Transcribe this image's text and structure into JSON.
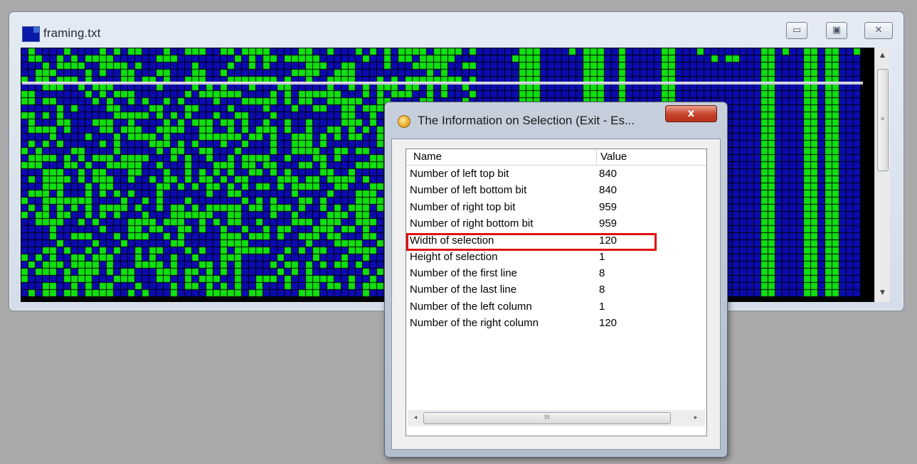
{
  "main_window": {
    "title": "framing.txt",
    "buttons": {
      "minimize": "▭",
      "maximize": "▣",
      "close": "✕"
    },
    "colors": {
      "bit_zero": "#0b0bb0",
      "bit_one": "#10e010",
      "background": "#000000",
      "selection_line": "#c7c7d8"
    }
  },
  "scrollbar": {
    "up_arrow": "▲",
    "down_arrow": "▼",
    "grip": "≡"
  },
  "dialog": {
    "title": "The Information on Selection (Exit - Es...",
    "close_label": "x",
    "columns": {
      "name": "Name",
      "value": "Value"
    },
    "rows": [
      {
        "name": "Number of left top bit",
        "value": "840"
      },
      {
        "name": "Number of left bottom bit",
        "value": "840"
      },
      {
        "name": "Number of right top bit",
        "value": "959"
      },
      {
        "name": "Number of right bottom bit",
        "value": "959"
      },
      {
        "name": "Width of selection",
        "value": "120"
      },
      {
        "name": "Height of selection",
        "value": "1"
      },
      {
        "name": "Number of the first line",
        "value": "8"
      },
      {
        "name": "Number of the last line",
        "value": "8"
      },
      {
        "name": "Number of the left column",
        "value": "1"
      },
      {
        "name": "Number of the right column",
        "value": "120"
      }
    ],
    "highlighted_row": "Width of selection",
    "highlight_color": "#e01010",
    "hscroll": {
      "left_arrow": "◂",
      "right_arrow": "▸",
      "grip": "III"
    }
  }
}
